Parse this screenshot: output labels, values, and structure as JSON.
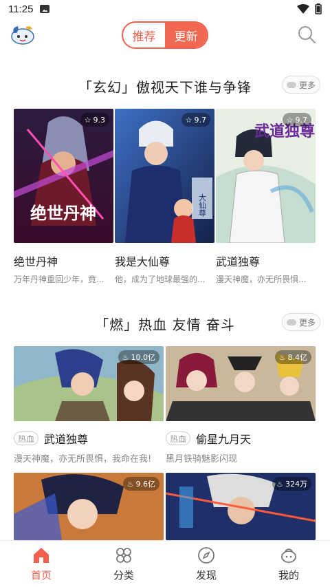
{
  "status_bar": {
    "time": "11:25"
  },
  "header": {
    "tabs": [
      {
        "label": "推荐",
        "active": false
      },
      {
        "label": "更新",
        "active": true
      }
    ]
  },
  "section1": {
    "title": "「玄幻」傲视天下谁与争锋",
    "more_label": "更多",
    "items": [
      {
        "title": "绝世丹神",
        "desc": "万年丹神重回少年，竟...",
        "rating": "9.3",
        "cover_text": "绝世丹神"
      },
      {
        "title": "我是大仙尊",
        "desc": "他，成为了地球最强的...",
        "rating": "9.7",
        "cover_text": "大仙尊"
      },
      {
        "title": "武道独尊",
        "desc": "漫天神魔，亦无所畏惧...",
        "rating": "9.7",
        "cover_text": "武道独尊"
      }
    ]
  },
  "section2": {
    "title": "「燃」热血 友情 奋斗",
    "more_label": "更多",
    "items": [
      {
        "tag": "热血",
        "title": "武道独尊",
        "desc": "漫天神魔，亦无所畏惧，我命在我!",
        "count": "10.0亿"
      },
      {
        "tag": "热血",
        "title": "偷星九月天",
        "desc": "黑月铁骑魅影闪现",
        "count": "8.4亿"
      },
      {
        "count": "9.6亿"
      },
      {
        "count": "324万"
      }
    ]
  },
  "bottom_nav": [
    {
      "label": "首页",
      "active": true
    },
    {
      "label": "分类",
      "active": false
    },
    {
      "label": "发现",
      "active": false
    },
    {
      "label": "我的",
      "active": false
    }
  ],
  "colors": {
    "accent": "#f25f4c",
    "text": "#222222",
    "muted": "#888888"
  }
}
